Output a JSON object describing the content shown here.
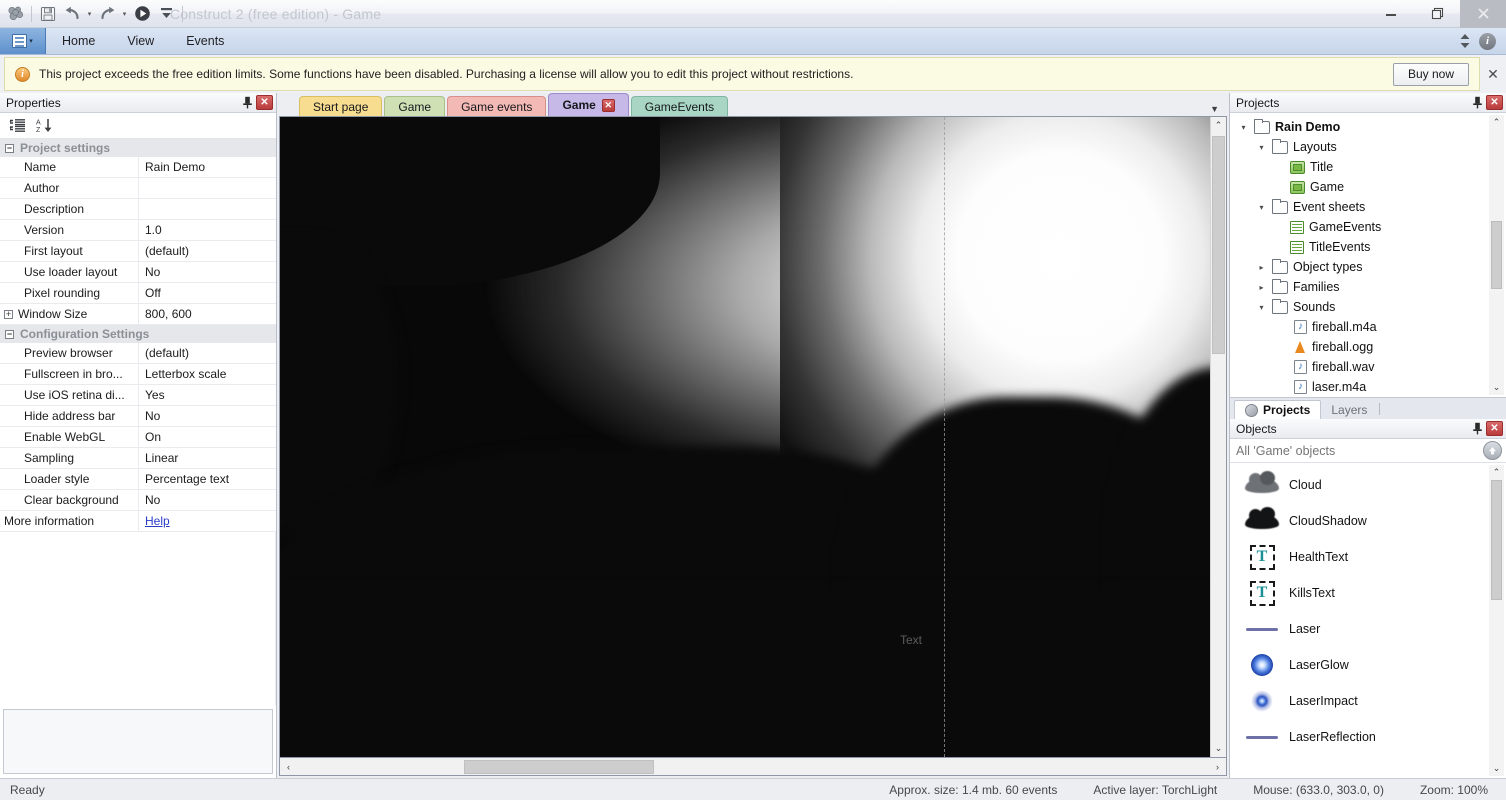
{
  "window": {
    "title": "Construct 2  (free edition) - Game",
    "quick_access": [
      {
        "name": "app-logo",
        "glyph": "logo"
      },
      {
        "name": "save",
        "glyph": "save"
      },
      {
        "name": "undo",
        "glyph": "undo"
      },
      {
        "name": "redo",
        "glyph": "redo"
      },
      {
        "name": "run",
        "glyph": "play"
      },
      {
        "name": "customize",
        "glyph": "caret"
      }
    ],
    "controls": {
      "minimize": "–",
      "restore": "❐",
      "close": "✕"
    }
  },
  "ribbon": {
    "file_button": "file-menu",
    "tabs": [
      {
        "label": "Home"
      },
      {
        "label": "View"
      },
      {
        "label": "Events"
      }
    ],
    "collapse": "▲▼",
    "info": "i"
  },
  "notification": {
    "icon": "i",
    "message": "This project exceeds the free edition limits.  Some functions have been disabled.  Purchasing a license will allow you to edit this project without restrictions.",
    "button": "Buy now",
    "close": "✕"
  },
  "properties": {
    "title": "Properties",
    "pin": "📌",
    "close": "✕",
    "toolbar": [
      {
        "name": "categorize-button",
        "glyph": "categorize"
      },
      {
        "name": "sort-alpha-button",
        "glyph": "sort-az"
      }
    ],
    "groups": [
      {
        "name": "Project settings",
        "expander": "−",
        "rows": [
          {
            "name": "Name",
            "value": "Rain Demo"
          },
          {
            "name": "Author",
            "value": ""
          },
          {
            "name": "Description",
            "value": ""
          },
          {
            "name": "Version",
            "value": "1.0"
          },
          {
            "name": "First layout",
            "value": "(default)"
          },
          {
            "name": "Use loader layout",
            "value": "No"
          },
          {
            "name": "Pixel rounding",
            "value": "Off"
          },
          {
            "name": "Window Size",
            "value": "800, 600",
            "expandable": true,
            "expander": "+"
          }
        ]
      },
      {
        "name": "Configuration Settings",
        "expander": "−",
        "rows": [
          {
            "name": "Preview browser",
            "value": "(default)"
          },
          {
            "name": "Fullscreen in bro...",
            "value": "Letterbox scale"
          },
          {
            "name": "Use iOS retina di...",
            "value": "Yes"
          },
          {
            "name": "Hide address bar",
            "value": "No"
          },
          {
            "name": "Enable WebGL",
            "value": "On"
          },
          {
            "name": "Sampling",
            "value": "Linear"
          },
          {
            "name": "Loader style",
            "value": "Percentage text"
          },
          {
            "name": "Clear background",
            "value": "No"
          }
        ]
      }
    ],
    "more_information": {
      "label": "More information",
      "link": "Help"
    }
  },
  "document_tabs": [
    {
      "label": "Start page",
      "color": "#f7dd8f",
      "border": "#d9bf62",
      "active": false,
      "closable": false
    },
    {
      "label": "Game",
      "color": "#cfe0b4",
      "border": "#a9c086",
      "active": false,
      "closable": false
    },
    {
      "label": "Game events",
      "color": "#f3b9b4",
      "border": "#d98f89",
      "active": false,
      "closable": false
    },
    {
      "label": "Game",
      "color": "#c6b9e8",
      "border": "#9c8cc9",
      "active": true,
      "closable": true,
      "close": "✕"
    },
    {
      "label": "GameEvents",
      "color": "#a9d6c4",
      "border": "#7fb7a1",
      "active": false,
      "closable": false
    }
  ],
  "canvas": {
    "text_object": "Text",
    "vscroll": {
      "up": "⌃",
      "down": "⌄"
    },
    "hscroll": {
      "left": "‹",
      "right": "›"
    }
  },
  "projects_panel": {
    "title": "Projects",
    "pin": "📌",
    "close": "✕",
    "tree": [
      {
        "label": "Rain Demo",
        "icon": "folder-icon",
        "depth": 0,
        "twisty": "▾",
        "bold": true
      },
      {
        "label": "Layouts",
        "icon": "folder-icon",
        "depth": 1,
        "twisty": "▾"
      },
      {
        "label": "Title",
        "icon": "layout-icon",
        "depth": 2,
        "twisty": ""
      },
      {
        "label": "Game",
        "icon": "layout-icon",
        "depth": 2,
        "twisty": ""
      },
      {
        "label": "Event sheets",
        "icon": "folder-icon",
        "depth": 1,
        "twisty": "▾"
      },
      {
        "label": "GameEvents",
        "icon": "eventsheet-icon",
        "depth": 2,
        "twisty": ""
      },
      {
        "label": "TitleEvents",
        "icon": "eventsheet-icon",
        "depth": 2,
        "twisty": ""
      },
      {
        "label": "Object types",
        "icon": "folder-icon",
        "depth": 1,
        "twisty": "▸"
      },
      {
        "label": "Families",
        "icon": "folder-icon",
        "depth": 1,
        "twisty": "▸"
      },
      {
        "label": "Sounds",
        "icon": "folder-icon",
        "depth": 1,
        "twisty": "▾"
      },
      {
        "label": "fireball.m4a",
        "icon": "audio-file-icon",
        "depth": 2,
        "twisty": ""
      },
      {
        "label": "fireball.ogg",
        "icon": "vlc-file-icon",
        "depth": 2,
        "twisty": ""
      },
      {
        "label": "fireball.wav",
        "icon": "audio-file-icon",
        "depth": 2,
        "twisty": ""
      },
      {
        "label": "laser.m4a",
        "icon": "audio-file-icon",
        "depth": 2,
        "twisty": ""
      }
    ],
    "scroll": {
      "up": "⌃",
      "down": "⌄"
    }
  },
  "dock_tabs": [
    {
      "label": "Projects",
      "active": true,
      "icon": "projects-icon"
    },
    {
      "label": "Layers",
      "active": false,
      "icon": ""
    }
  ],
  "objects_panel": {
    "title": "Objects",
    "pin": "📌",
    "close": "✕",
    "search_placeholder": "All 'Game' objects",
    "search_value": "",
    "up_button": "▲",
    "items": [
      {
        "label": "Cloud",
        "icon": "cloud-icon"
      },
      {
        "label": "CloudShadow",
        "icon": "cloud-shadow-icon"
      },
      {
        "label": "HealthText",
        "icon": "text-object-icon"
      },
      {
        "label": "KillsText",
        "icon": "text-object-icon"
      },
      {
        "label": "Laser",
        "icon": "line-icon"
      },
      {
        "label": "LaserGlow",
        "icon": "glow-icon"
      },
      {
        "label": "LaserImpact",
        "icon": "impact-icon"
      },
      {
        "label": "LaserReflection",
        "icon": "line-icon"
      }
    ],
    "scroll": {
      "up": "⌃",
      "down": "⌄"
    }
  },
  "status_bar": {
    "ready": "Ready",
    "size": "Approx. size: 1.4 mb. 60 events",
    "active_layer": "Active layer: TorchLight",
    "mouse": "Mouse: (633.0, 303.0, 0)",
    "zoom": "Zoom: 100%"
  }
}
